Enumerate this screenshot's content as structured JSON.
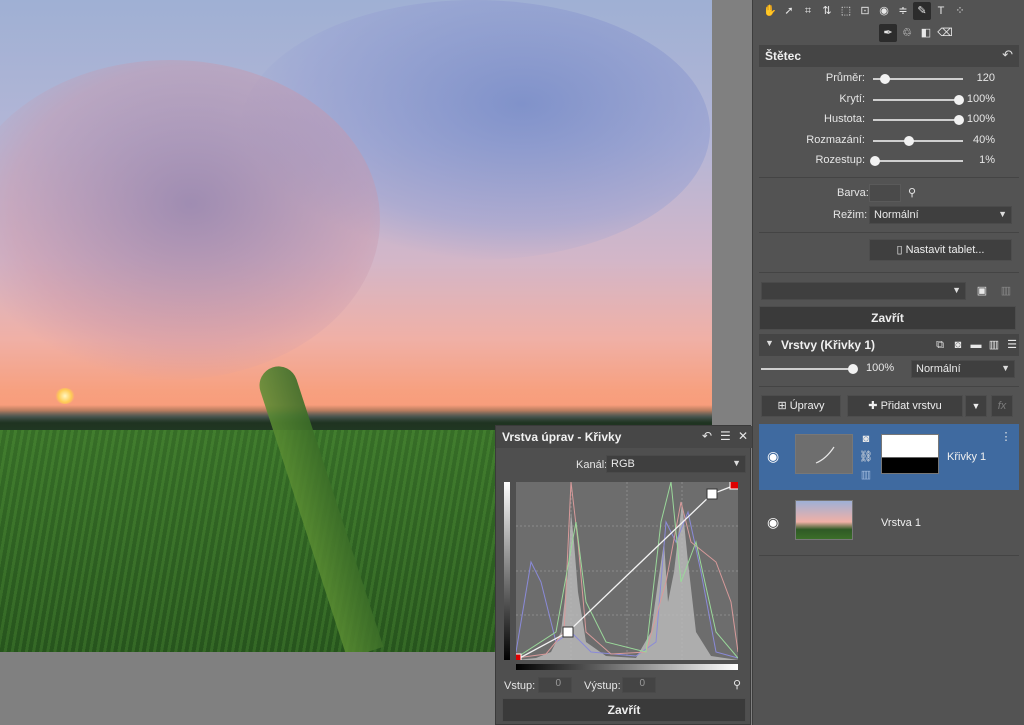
{
  "toolbar": {
    "tools": [
      "hand-icon",
      "pointer-icon",
      "crop-icon",
      "align-icon",
      "perspective-icon",
      "text-box-icon",
      "eye-icon",
      "straighten-icon",
      "brush-tool-icon",
      "text-icon",
      "more-icon"
    ],
    "subtools": [
      "brush-icon",
      "clone-icon",
      "gradient-icon",
      "eraser-icon"
    ]
  },
  "brush_panel": {
    "title": "Štětec",
    "sliders": [
      {
        "label": "Průměr:",
        "value": "120",
        "pos": 0.1
      },
      {
        "label": "Krytí:",
        "value": "100%",
        "pos": 1.0
      },
      {
        "label": "Hustota:",
        "value": "100%",
        "pos": 1.0
      },
      {
        "label": "Rozmazání:",
        "value": "40%",
        "pos": 0.4
      },
      {
        "label": "Rozestup:",
        "value": "1%",
        "pos": 0.0
      }
    ],
    "color_label": "Barva:",
    "mode_label": "Režim:",
    "mode_value": "Normální",
    "tablet_button": "Nastavit tablet...",
    "preset_value": "",
    "close_button": "Zavřít"
  },
  "layers_panel": {
    "title": "Vrstvy (Křivky 1)",
    "opacity_value": "100%",
    "blend_mode": "Normální",
    "adjustments_button": "Úpravy",
    "add_layer_button": "Přidat vrstvu",
    "fx_label": "fx",
    "layers": [
      {
        "name": "Křivky 1",
        "selected": true
      },
      {
        "name": "Vrstva 1",
        "selected": false
      }
    ]
  },
  "curves_dialog": {
    "title": "Vrstva úprav - Křivky",
    "channel_label": "Kanál:",
    "channel_value": "RGB",
    "input_label": "Vstup:",
    "input_value": "0",
    "output_label": "Výstup:",
    "output_value": "0",
    "close_button": "Zavřít"
  }
}
